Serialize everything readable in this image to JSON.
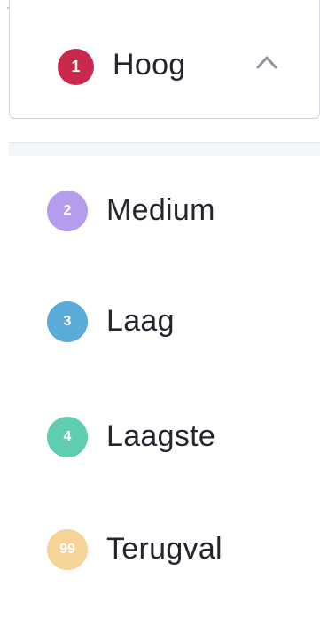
{
  "trigger": {
    "badge": "1",
    "label": "Hoog",
    "badge_color": "#c8294d",
    "icon": "chevron-up-icon"
  },
  "options": [
    {
      "badge": "2",
      "label": "Medium",
      "badge_color": "#b59cec"
    },
    {
      "badge": "3",
      "label": "Laag",
      "badge_color": "#5aabd9"
    },
    {
      "badge": "4",
      "label": "Laagste",
      "badge_color": "#5fcdb0"
    },
    {
      "badge": "99",
      "label": "Terugval",
      "badge_color": "#f6d497"
    }
  ]
}
